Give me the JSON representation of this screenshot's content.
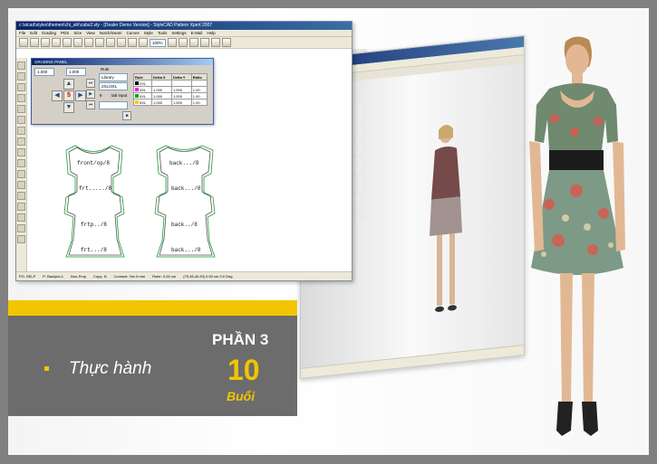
{
  "slide": {
    "part_label": "PHẦN 3",
    "bullet_text": "Thực hành",
    "count": "10",
    "count_unit": "Buổi"
  },
  "colors": {
    "accent_yellow": "#f2c500",
    "banner_gray": "#6c6c6c",
    "frame_gray": "#808080"
  },
  "app": {
    "title": "c:\\stcad\\styles\\themes\\chi_ahi\\cabs2.sty - [Dealer Demo Version] - StyleCAD Pattern Xpert 2007",
    "menu": [
      "File",
      "Edit",
      "Grading",
      "PDS",
      "Size",
      "View",
      "Notch/Seam",
      "Curves",
      "Style",
      "Tools",
      "Settings",
      "E-Mail",
      "Help"
    ],
    "zoom": "100%",
    "status": [
      "PG: SELP",
      "P: Backpnl-1",
      "Non-Prop",
      "Copy: N",
      "Connect: Yes 5.mm",
      "Ruler: 0.00 cm",
      "(75.28,40.20) 0.00 cm 0.0 Deg"
    ]
  },
  "grading_panel": {
    "title": "GRADING PANEL",
    "x_value": "1.000",
    "y_value": "1.000",
    "rule_label": "Rule",
    "library": "Library",
    "rule_value": "2XL/3XL",
    "rule_id": "8",
    "tab_input": "tab input",
    "center_value": "5",
    "table": {
      "headers": [
        "Rule",
        "Delta X",
        "Delta Y",
        "Ratio"
      ],
      "rows": [
        [
          "2XL",
          "",
          "",
          ""
        ],
        [
          "3XL",
          "1.000",
          "1.000",
          "1.00"
        ],
        [
          "4XL",
          "1.000",
          "1.000",
          "1.00"
        ],
        [
          "5XL",
          "1.000",
          "1.000",
          "1.00"
        ]
      ],
      "swatches": [
        "#000000",
        "#ff00ff",
        "#00aa00",
        "#ffcc00"
      ]
    }
  },
  "patterns": {
    "labels": [
      "front/op/8",
      "frt...../8",
      "frtp../8",
      "frt.../8",
      "back.../8",
      "back.../8",
      "back../8",
      "back.../8"
    ]
  }
}
